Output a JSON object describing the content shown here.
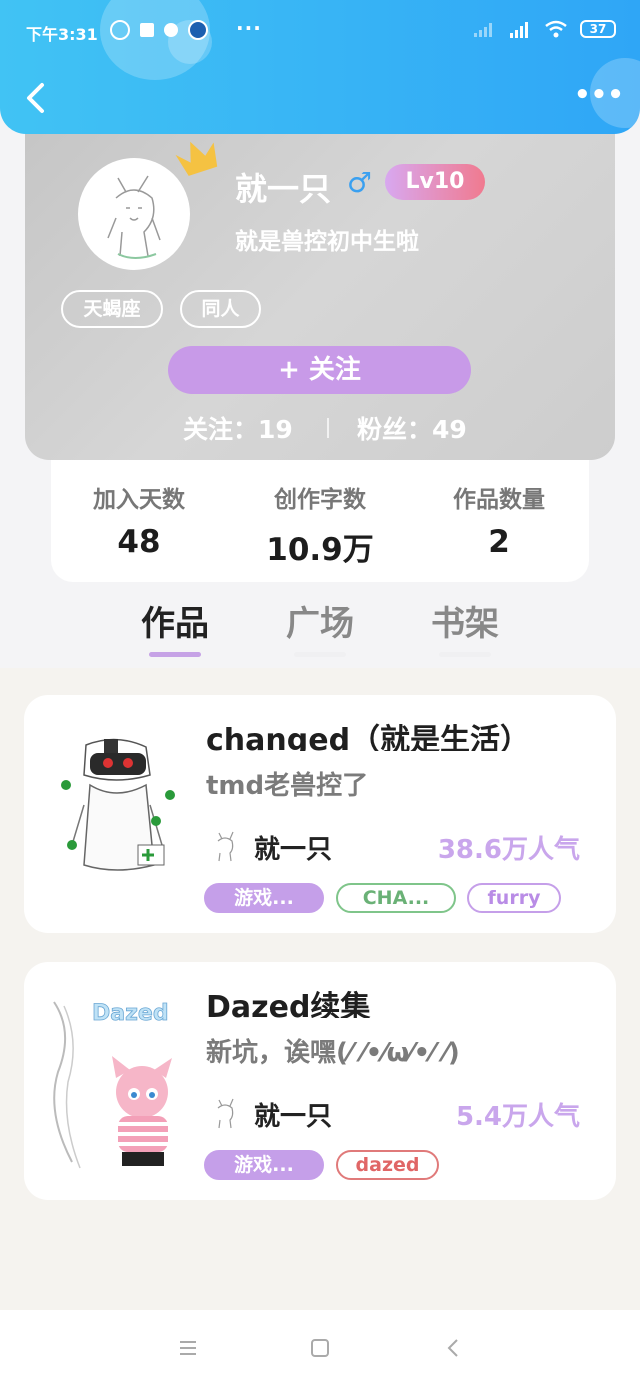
{
  "status_bar": {
    "time": "下午3:31",
    "more": "···",
    "battery": "37"
  },
  "header": {
    "more": "•••"
  },
  "profile": {
    "nickname": "就一只",
    "gender_symbol": "♂",
    "level": "Lv10",
    "bio": "就是兽控初中生啦",
    "tags": [
      "天蝎座",
      "同人"
    ],
    "follow_button": "+   关注",
    "following": "关注：19",
    "followers": "粉丝：49"
  },
  "stats": [
    {
      "label": "加入天数",
      "value": "48"
    },
    {
      "label": "创作字数",
      "value": "10.9万"
    },
    {
      "label": "作品数量",
      "value": "2"
    }
  ],
  "tabs": [
    "作品",
    "广场",
    "书架"
  ],
  "works": [
    {
      "title": "changed（就是生活）",
      "description": "tmd老兽控了",
      "author": "就一只",
      "popularity": "38.6万人气",
      "tags": [
        "游戏...",
        "CHA...",
        "furry"
      ]
    },
    {
      "title": "Dazed续集",
      "description": "新坑，诶嘿(⁄ ⁄•⁄ω⁄•⁄ ⁄)",
      "author": "就一只",
      "popularity": "5.4万人气",
      "tags": [
        "游戏...",
        "dazed"
      ],
      "cover_text": "Dazed"
    }
  ],
  "colors": {
    "header_gradient_start": "#41c3f4",
    "header_gradient_end": "#2fa6f6",
    "accent_purple": "#c89ae8",
    "popularity": "#c9a6ec"
  }
}
